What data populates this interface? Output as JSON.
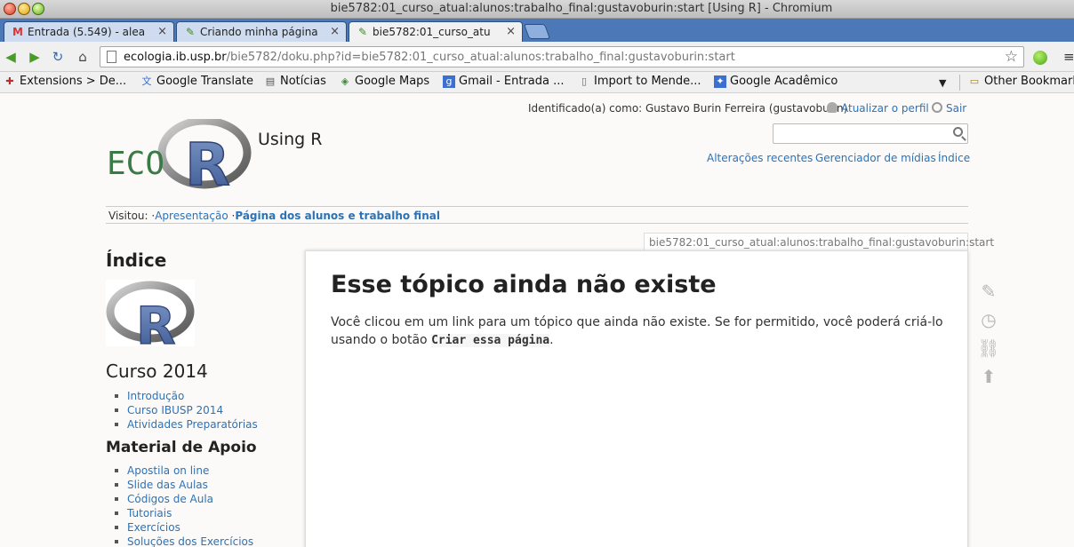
{
  "window": {
    "title": "bie5782:01_curso_atual:alunos:trabalho_final:gustavoburin:start [Using R] - Chromium"
  },
  "tabs": [
    {
      "label": "Entrada (5.549) - alea",
      "icon": "gmail-icon"
    },
    {
      "label": "Criando minha página",
      "icon": "dokuwiki-icon"
    },
    {
      "label": "bie5782:01_curso_atu",
      "icon": "dokuwiki-icon"
    }
  ],
  "toolbar": {
    "url_host": "ecologia.ib.usp.br",
    "url_path": "/bie5782/doku.php?id=bie5782:01_curso_atual:alunos:trabalho_final:gustavoburin:start"
  },
  "bookmarks": [
    {
      "label": "Extensions > De...",
      "icon": "puzzle-icon"
    },
    {
      "label": "Google Translate",
      "icon": "translate-icon"
    },
    {
      "label": "Notícias",
      "icon": "news-icon"
    },
    {
      "label": "Google Maps",
      "icon": "maps-icon"
    },
    {
      "label": "Gmail - Entrada ...",
      "icon": "google-icon"
    },
    {
      "label": "Import to Mende...",
      "icon": "page-icon"
    },
    {
      "label": "Google Acadêmico",
      "icon": "scholar-icon"
    },
    {
      "label": "Other Bookmark",
      "icon": "folder-icon"
    }
  ],
  "header": {
    "user_label": "Identificado(a) como: Gustavo Burin Ferreira (gustavoburin)",
    "update_profile": "Atualizar o perfil",
    "logout": "Sair",
    "site_title": "Using R",
    "logo_text": "ECO",
    "site_tools": [
      "Alterações recentes",
      "Gerenciador de mídias",
      "Índice"
    ]
  },
  "breadcrumbs": {
    "label": "Visitou:",
    "sep": "·",
    "items": [
      "Apresentação",
      "Página dos alunos e trabalho final"
    ]
  },
  "sidebar": {
    "index_title": "Índice",
    "sections": [
      {
        "title": "Curso 2014",
        "items": [
          "Introdução",
          "Curso IBUSP 2014",
          "Atividades Preparatórias"
        ]
      },
      {
        "title": "Material de Apoio",
        "items": [
          "Apostila on line",
          "Slide das Aulas",
          "Códigos de Aula",
          "Tutoriais",
          "Exercícios",
          "Soluções dos Exercícios"
        ]
      }
    ]
  },
  "content": {
    "page_id": "bie5782:01_curso_atual:alunos:trabalho_final:gustavoburin:start",
    "heading": "Esse tópico ainda não existe",
    "text_before": "Você clicou em um link para um tópico que ainda não existe. Se for permitido, você poderá criá-lo usando o botão ",
    "code": "Criar essa página",
    "text_after": "."
  },
  "page_tools": [
    "edit-icon",
    "revisions-icon",
    "backlinks-icon",
    "back-to-top-icon"
  ]
}
